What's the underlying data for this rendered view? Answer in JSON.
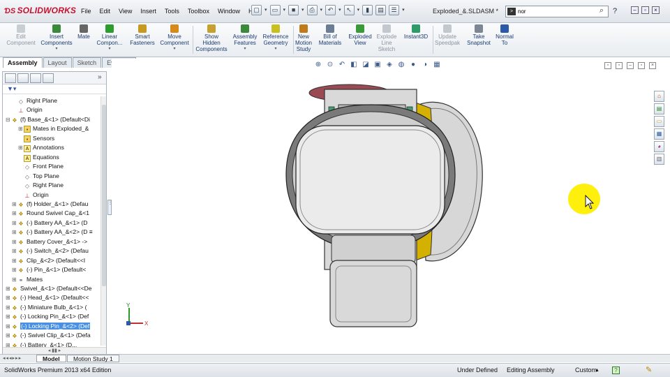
{
  "app": {
    "brand": "SOLIDWORKS",
    "document_title": "Exploded_&.SLDASM *"
  },
  "menu": [
    "File",
    "Edit",
    "View",
    "Insert",
    "Tools",
    "Toolbox",
    "Window",
    "Help"
  ],
  "search": {
    "value": "nor",
    "prompt_icon": ">"
  },
  "command_manager": [
    {
      "label": "Edit\nComponent",
      "icon": "edit-component-icon",
      "enabled": false
    },
    {
      "label": "Insert\nComponents",
      "icon": "insert-components-icon",
      "enabled": true
    },
    {
      "label": "Mate",
      "icon": "mate-icon",
      "enabled": true
    },
    {
      "label": "Linear\nCompon...",
      "icon": "linear-pattern-icon",
      "enabled": true
    },
    {
      "label": "Smart\nFasteners",
      "icon": "smart-fasteners-icon",
      "enabled": true
    },
    {
      "label": "Move\nComponent",
      "icon": "move-component-icon",
      "enabled": true
    },
    {
      "label": "Show\nHidden\nComponents",
      "icon": "show-hidden-icon",
      "enabled": true
    },
    {
      "label": "Assembly\nFeatures",
      "icon": "assembly-features-icon",
      "enabled": true
    },
    {
      "label": "Reference\nGeometry",
      "icon": "reference-geometry-icon",
      "enabled": true
    },
    {
      "label": "New\nMotion\nStudy",
      "icon": "motion-study-icon",
      "enabled": true
    },
    {
      "label": "Bill of\nMaterials",
      "icon": "bom-icon",
      "enabled": true
    },
    {
      "label": "Exploded\nView",
      "icon": "exploded-view-icon",
      "enabled": true
    },
    {
      "label": "Explode\nLine\nSketch",
      "icon": "explode-line-icon",
      "enabled": false
    },
    {
      "label": "Instant3D",
      "icon": "instant3d-icon",
      "enabled": true
    },
    {
      "label": "Update\nSpeedpak",
      "icon": "speedpak-icon",
      "enabled": false
    },
    {
      "label": "Take\nSnapshot",
      "icon": "snapshot-icon",
      "enabled": true
    },
    {
      "label": "Normal\nTo",
      "icon": "normal-to-icon",
      "enabled": true
    }
  ],
  "tabs": [
    {
      "label": "Assembly",
      "active": true
    },
    {
      "label": "Layout",
      "active": false
    },
    {
      "label": "Sketch",
      "active": false
    },
    {
      "label": "Evaluate",
      "active": false
    }
  ],
  "tree": [
    {
      "label": "Right Plane",
      "icon": "plane",
      "depth": 1,
      "exp": ""
    },
    {
      "label": "Origin",
      "icon": "origin",
      "depth": 1,
      "exp": ""
    },
    {
      "label": "(f) Base_&<1> (Default<Di",
      "icon": "part",
      "depth": 0,
      "exp": "−"
    },
    {
      "label": "Mates in Exploded_&",
      "icon": "folder",
      "depth": 2,
      "exp": "+"
    },
    {
      "label": "Sensors",
      "icon": "folder",
      "depth": 2,
      "exp": ""
    },
    {
      "label": "Annotations",
      "icon": "ann",
      "depth": 2,
      "exp": "+"
    },
    {
      "label": "Equations",
      "icon": "ann",
      "depth": 2,
      "exp": ""
    },
    {
      "label": "Front Plane",
      "icon": "plane",
      "depth": 2,
      "exp": ""
    },
    {
      "label": "Top Plane",
      "icon": "plane",
      "depth": 2,
      "exp": ""
    },
    {
      "label": "Right Plane",
      "icon": "plane",
      "depth": 2,
      "exp": ""
    },
    {
      "label": "Origin",
      "icon": "origin",
      "depth": 2,
      "exp": ""
    },
    {
      "label": "(f) Holder_&<1> (Defau",
      "icon": "part",
      "depth": 1,
      "exp": "+"
    },
    {
      "label": "Round Swivel Cap_&<1",
      "icon": "part",
      "depth": 1,
      "exp": "+"
    },
    {
      "label": "(-) Battery AA_&<1> (D",
      "icon": "part",
      "depth": 1,
      "exp": "+"
    },
    {
      "label": "(-) Battery AA_&<2> (D ≡",
      "icon": "part",
      "depth": 1,
      "exp": "+"
    },
    {
      "label": "Battery Cover_&<1> ->",
      "icon": "part",
      "depth": 1,
      "exp": "+"
    },
    {
      "label": "(-) Switch_&<2> (Defau",
      "icon": "part",
      "depth": 1,
      "exp": "+"
    },
    {
      "label": "Clip_&<2> (Default<<I",
      "icon": "part",
      "depth": 1,
      "exp": "+"
    },
    {
      "label": "(-) Pin_&<1> (Default<",
      "icon": "part",
      "depth": 1,
      "exp": "+"
    },
    {
      "label": "Mates",
      "icon": "mates",
      "depth": 1,
      "exp": "+"
    },
    {
      "label": "Swivel_&<1> (Default<<De",
      "icon": "part",
      "depth": 0,
      "exp": "+"
    },
    {
      "label": "(-) Head_&<1> (Default<<",
      "icon": "part",
      "depth": 0,
      "exp": "+"
    },
    {
      "label": "(-) Miniature Bulb_&<1> (",
      "icon": "part",
      "depth": 0,
      "exp": "+"
    },
    {
      "label": "(-) Locking Pin_&<1> (Def",
      "icon": "part",
      "depth": 0,
      "exp": "+"
    },
    {
      "label": "(-) Locking Pin_&<2> (Def",
      "icon": "part",
      "depth": 0,
      "exp": "+",
      "selected": true
    },
    {
      "label": "(-) Swivel Clip_&<1> (Defa",
      "icon": "part",
      "depth": 0,
      "exp": "+"
    },
    {
      "label": "(-) Battery_&<1> (D...",
      "icon": "part",
      "depth": 0,
      "exp": "+"
    }
  ],
  "bottom_tabs": [
    {
      "label": "Model",
      "active": true
    },
    {
      "label": "Motion Study 1",
      "active": false
    }
  ],
  "status": {
    "edition": "SolidWorks Premium 2013 x64 Edition",
    "state": "Under Defined",
    "mode": "Editing Assembly",
    "units": "Custom",
    "units_arrow": "▲",
    "help_icon": "?"
  },
  "triad": {
    "x": "X",
    "y": "Y"
  },
  "colors": {
    "accent": "#c8102e",
    "selection": "#4a90e2",
    "part_gray": "#e2e2e2",
    "part_gold": "#d4b000",
    "cursor_highlight": "#ffee00"
  }
}
